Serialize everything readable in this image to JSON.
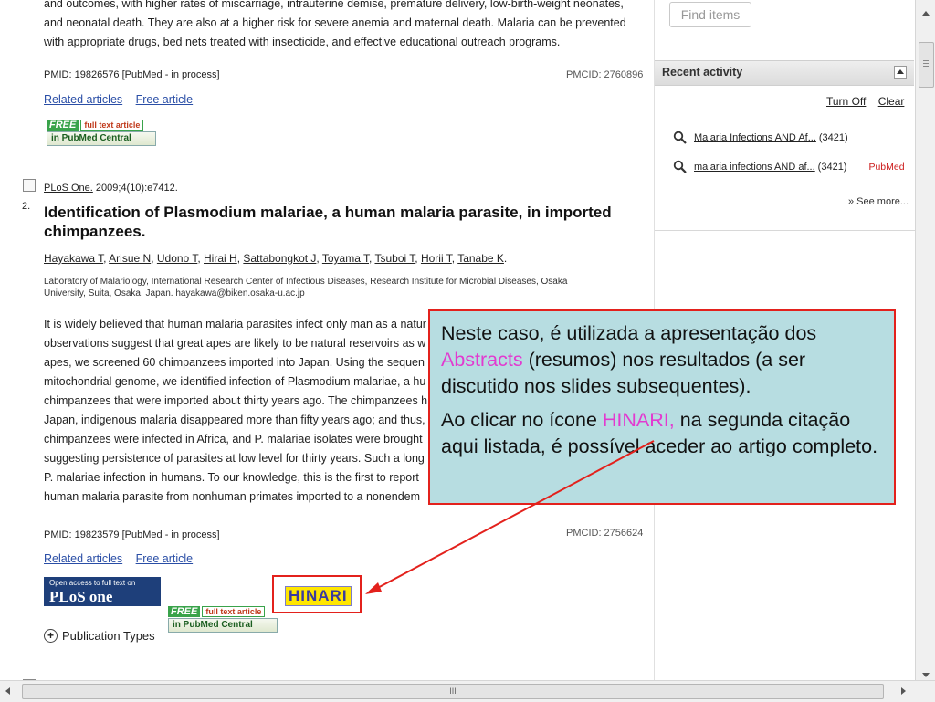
{
  "result1": {
    "abstract_lines": [
      "and outcomes, with higher rates of miscarriage, intrauterine demise, premature delivery, low-birth-weight neonates,",
      "and neonatal death. They are also at a higher risk for severe anemia and maternal death. Malaria can be prevented",
      "with appropriate drugs, bed nets treated with insecticide, and effective educational outreach programs."
    ],
    "pmid": "PMID: 19826576 [PubMed - in process]",
    "pmcid": "PMCID: 2760896",
    "related": "Related articles",
    "free": "Free article",
    "free_badge": {
      "word": "FREE",
      "rest": "full text article",
      "bottom": "in PubMed Central"
    }
  },
  "result2": {
    "number": "2.",
    "journal": "PLoS One.",
    "citation": " 2009;4(10):e7412.",
    "title_line1": "Identification of Plasmodium malariae, a human malaria parasite, in imported",
    "title_line2": "chimpanzees.",
    "authors": [
      "Hayakawa T",
      "Arisue N",
      "Udono T",
      "Hirai H",
      "Sattabongkot J",
      "Toyama T",
      "Tsuboi T",
      "Horii T",
      "Tanabe K"
    ],
    "affiliation_line1": "Laboratory of Malariology, International Research Center of Infectious Diseases, Research Institute for Microbial Diseases, Osaka",
    "affiliation_line2": "University, Suita, Osaka, Japan. hayakawa@biken.osaka-u.ac.jp",
    "abstract_lines": [
      "It is widely believed that human malaria parasites infect only man as a natur",
      "observations suggest that great apes are likely to be natural reservoirs as w",
      "apes, we screened 60 chimpanzees imported into Japan. Using the sequen",
      "mitochondrial genome, we identified infection of Plasmodium malariae, a hu",
      "chimpanzees that were imported about thirty years ago. The chimpanzees h",
      "Japan, indigenous malaria disappeared more than fifty years ago; and thus,",
      "chimpanzees were infected in Africa, and P. malariae isolates were brought",
      "suggesting persistence of parasites at low level for thirty years. Such a long",
      "P. malariae infection in humans. To our knowledge, this is the first to report",
      "human malaria parasite from nonhuman primates imported to a nonendem"
    ],
    "pmid": "PMID: 19823579 [PubMed - in process]",
    "pmcid": "PMCID: 2756624",
    "related": "Related articles",
    "free": "Free article",
    "plos_badge": {
      "top": "Open access to full text on",
      "bottom": "PLoS one"
    },
    "free_badge": {
      "word": "FREE",
      "rest": "full text article",
      "bottom": "in PubMed Central"
    },
    "hinari_label": "HINARI",
    "publication_types": "Publication Types"
  },
  "sidebar": {
    "find_items": "Find items",
    "recent_activity": "Recent activity",
    "turn_off": "Turn Off",
    "clear": "Clear",
    "items": [
      {
        "label": "Malaria Infections AND Af...",
        "count": "(3421)",
        "source": ""
      },
      {
        "label": "malaria infections AND af...",
        "count": "(3421)",
        "source": "PubMed"
      }
    ],
    "see_more": "» See more..."
  },
  "callout": {
    "p1_before": "Neste caso, é utilizada a apresentação dos ",
    "p1_highlight": "Abstracts",
    "p1_after": " (resumos) nos resultados (a ser discutido nos slides subsequentes).",
    "p2_before": "Ao clicar no ícone ",
    "p2_highlight": "HINARI,",
    "p2_after": " na segunda citação aqui listada, é possível aceder ao artigo completo."
  },
  "colors": {
    "callout_bg": "#b7dde1",
    "callout_border": "#e3211c",
    "highlight": "#e23ad0",
    "link": "#2a4ea6",
    "pubmed_tag": "#cc1b1b"
  },
  "scroll_marker": "III"
}
